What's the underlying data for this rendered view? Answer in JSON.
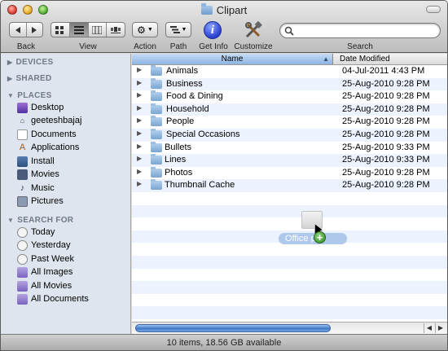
{
  "window": {
    "title": "Clipart"
  },
  "toolbar": {
    "back_label": "Back",
    "view_label": "View",
    "action_label": "Action",
    "path_label": "Path",
    "getinfo_label": "Get Info",
    "customize_label": "Customize",
    "search_label": "Search",
    "search_placeholder": ""
  },
  "sidebar": {
    "devices_header": "DEVICES",
    "shared_header": "SHARED",
    "places_header": "PLACES",
    "places": [
      {
        "label": "Desktop",
        "icon": "desktop-icon"
      },
      {
        "label": "geeteshbajaj",
        "icon": "home-icon"
      },
      {
        "label": "Documents",
        "icon": "documents-icon"
      },
      {
        "label": "Applications",
        "icon": "applications-icon"
      },
      {
        "label": "Install",
        "icon": "folder-icon"
      },
      {
        "label": "Movies",
        "icon": "movies-icon"
      },
      {
        "label": "Music",
        "icon": "music-icon"
      },
      {
        "label": "Pictures",
        "icon": "pictures-icon"
      }
    ],
    "search_header": "SEARCH FOR",
    "searches": [
      {
        "label": "Today",
        "icon": "clock-icon"
      },
      {
        "label": "Yesterday",
        "icon": "clock-icon"
      },
      {
        "label": "Past Week",
        "icon": "clock-icon"
      },
      {
        "label": "All Images",
        "icon": "smart-folder-icon"
      },
      {
        "label": "All Movies",
        "icon": "smart-folder-icon"
      },
      {
        "label": "All Documents",
        "icon": "smart-folder-icon"
      }
    ]
  },
  "list": {
    "name_header": "Name",
    "date_header": "Date Modified",
    "rows": [
      {
        "name": "Animals",
        "date": "04-Jul-2011 4:43 PM"
      },
      {
        "name": "Business",
        "date": "25-Aug-2010 9:28 PM"
      },
      {
        "name": "Food & Dining",
        "date": "25-Aug-2010 9:28 PM"
      },
      {
        "name": "Household",
        "date": "25-Aug-2010 9:28 PM"
      },
      {
        "name": "People",
        "date": "25-Aug-2010 9:28 PM"
      },
      {
        "name": "Special Occasions",
        "date": "25-Aug-2010 9:28 PM"
      },
      {
        "name": "Bullets",
        "date": "25-Aug-2010 9:33 PM"
      },
      {
        "name": "Lines",
        "date": "25-Aug-2010 9:33 PM"
      },
      {
        "name": "Photos",
        "date": "25-Aug-2010 9:28 PM"
      },
      {
        "name": "Thumbnail Cache",
        "date": "25-Aug-2010 9:28 PM"
      }
    ],
    "drag_label": "Office ple",
    "drag_badge": "+"
  },
  "status": {
    "text": "10 items, 18.56 GB available"
  },
  "colors": {
    "accent": "#3f78c8",
    "sidebar_bg": "#dfe5ee",
    "row_alt": "#edf3fe"
  }
}
